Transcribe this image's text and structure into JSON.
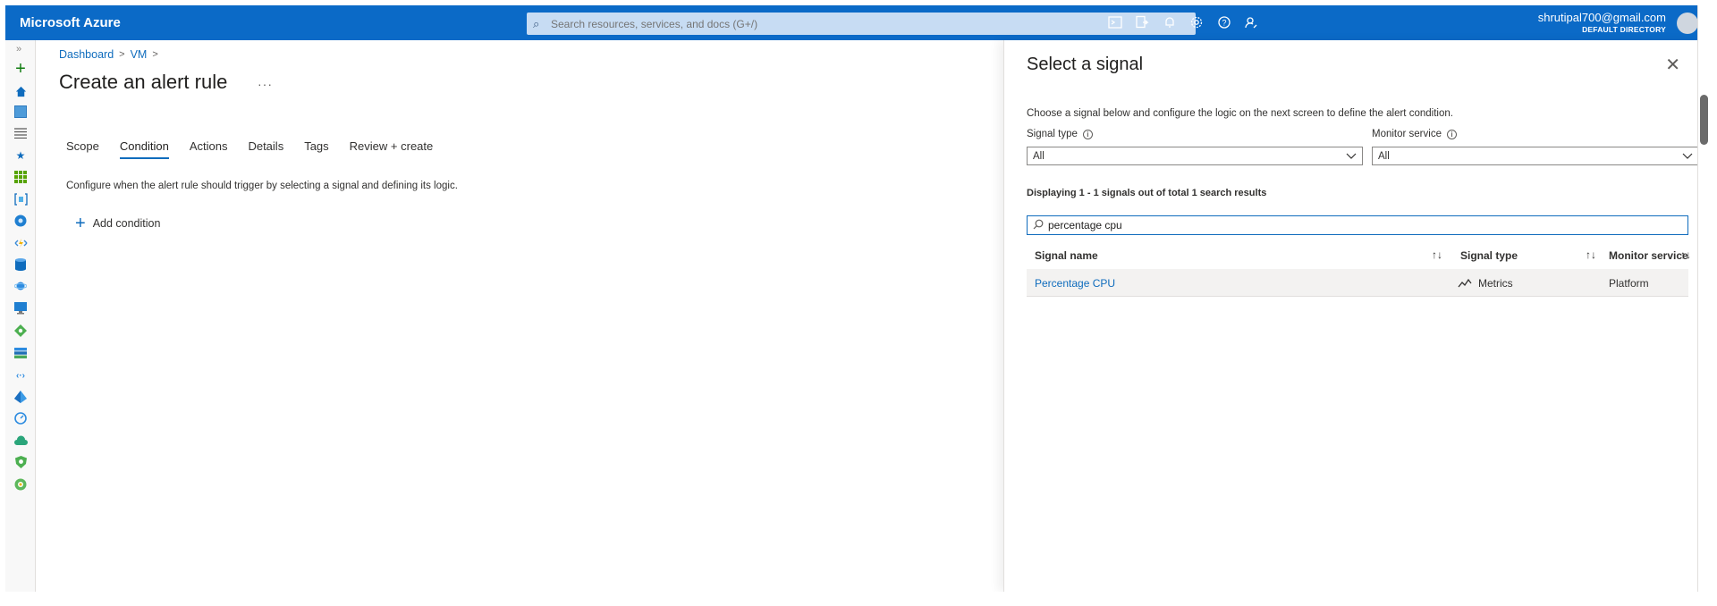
{
  "topbar": {
    "brand": "Microsoft Azure",
    "search_placeholder": "Search resources, services, and docs (G+/)",
    "icons": [
      "cloud-shell-icon",
      "directory-filter-icon",
      "notifications-bell-icon",
      "settings-gear-icon",
      "help-question-icon",
      "feedback-icon"
    ],
    "account_email": "shrutipal700@gmail.com",
    "account_directory": "DEFAULT DIRECTORY"
  },
  "rail": {
    "expand_glyph": "»",
    "icons": [
      "create-resource-plus-icon",
      "home-icon",
      "dashboard-icon",
      "all-services-list-icon",
      "favorites-star-icon",
      "all-resources-grid-icon",
      "resource-groups-icon",
      "app-services-globe-icon",
      "function-app-icon",
      "sql-database-icon",
      "cosmos-db-icon",
      "virtual-machines-icon",
      "load-balancer-icon",
      "storage-accounts-icon",
      "virtual-networks-icon",
      "azure-ad-icon",
      "monitor-icon",
      "advisor-icon",
      "security-center-icon",
      "cost-management-icon"
    ]
  },
  "breadcrumb": {
    "items": [
      "Dashboard",
      "VM"
    ],
    "sep": ">"
  },
  "page": {
    "title": "Create an alert rule",
    "more": "···"
  },
  "tabs": [
    {
      "label": "Scope"
    },
    {
      "label": "Condition"
    },
    {
      "label": "Actions"
    },
    {
      "label": "Details"
    },
    {
      "label": "Tags"
    },
    {
      "label": "Review + create"
    }
  ],
  "condition": {
    "description": "Configure when the alert rule should trigger by selecting a signal and defining its logic.",
    "add_label": "Add condition",
    "add_glyph": "+"
  },
  "panel": {
    "title": "Select a signal",
    "close_glyph": "✕",
    "description": "Choose a signal below and configure the logic on the next screen to define the alert condition.",
    "signal_type_label": "Signal type",
    "signal_type_value": "All",
    "monitor_service_label": "Monitor service",
    "monitor_service_value": "All",
    "results_count": "Displaying 1 - 1 signals out of total 1 search results",
    "search_value": "percentage cpu",
    "columns": {
      "name": "Signal name",
      "type": "Signal type",
      "service": "Monitor service",
      "sort_glyph": "↑↓"
    },
    "rows": [
      {
        "name": "Percentage CPU",
        "type": "Metrics",
        "service": "Platform"
      }
    ]
  },
  "colors": {
    "topbar": "#0b6ac7",
    "accent": "#0f6cbd"
  }
}
